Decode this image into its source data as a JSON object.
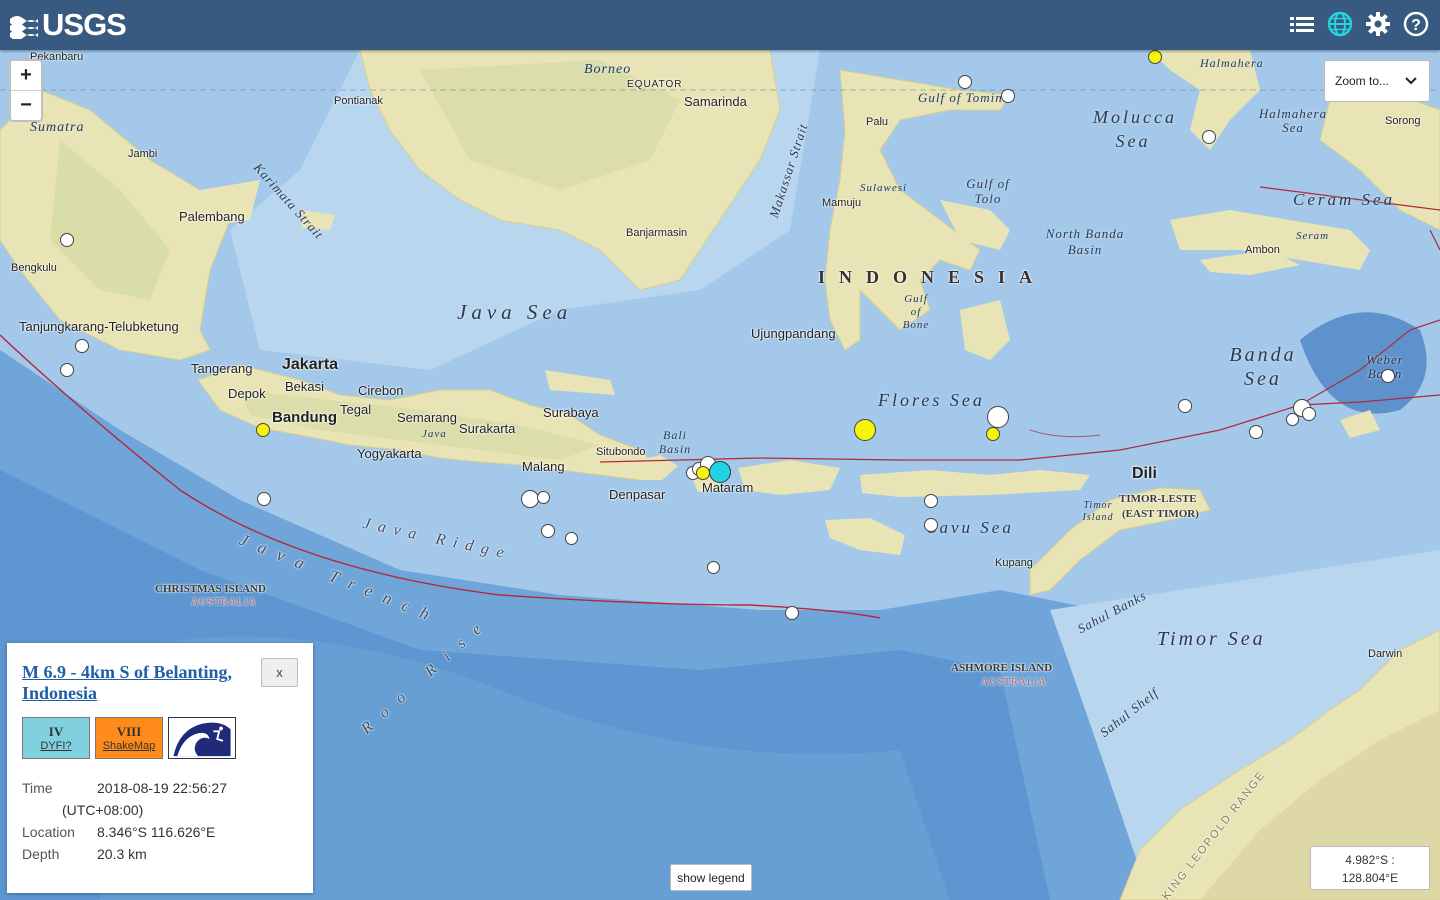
{
  "header": {
    "logo_text": "USGS",
    "icons": [
      "list-icon",
      "globe-icon",
      "gear-icon",
      "help-icon"
    ]
  },
  "map": {
    "zoom_in": "+",
    "zoom_out": "−",
    "zoom_to_label": "Zoom to...",
    "show_legend": "show legend",
    "coordinates": {
      "lat": "4.982°S :",
      "lon": "128.804°E"
    },
    "labels": {
      "pekanbaru": "Pekanbaru",
      "borneo": "Borneo",
      "equator": "EQUATOR",
      "halmahera": "Halmahera",
      "pontianak": "Pontianak",
      "samarinda": "Samarinda",
      "gulf_tomini": "Gulf of Tomini",
      "molucca_sea": "Molucca Sea",
      "halmahera_sea": "Halmahera Sea",
      "sorong": "Sorong",
      "sumatra": "Sumatra",
      "karimata": "Karimata Strait",
      "makassar": "Makassar Strait",
      "palu": "Palu",
      "jambi": "Jambi",
      "sulawesi": "Sulawesi",
      "gulf_tolo": "Gulf of Tolo",
      "ceram_sea": "Ceram Sea",
      "mamuju": "Mamuju",
      "palembang": "Palembang",
      "banjarmasin": "Banjarmasin",
      "north_banda": "North Banda Basin",
      "seram": "Seram",
      "ambon": "Ambon",
      "bengkulu": "Bengkulu",
      "indonesia": "INDONESIA",
      "gulf_bone": "Gulf of Bone",
      "java_sea": "Java Sea",
      "tanjung": "Tanjungkarang-Telubketung",
      "ujung": "Ujungpandang",
      "banda_sea": "Banda Sea",
      "weber": "Weber Basin",
      "jakarta": "Jakarta",
      "tangerang": "Tangerang",
      "bekasi": "Bekasi",
      "cirebon": "Cirebon",
      "depok": "Depok",
      "tegal": "Tegal",
      "bandung": "Bandung",
      "semarang": "Semarang",
      "java": "Java",
      "flores_sea": "Flores Sea",
      "surabaya": "Surabaya",
      "surakarta": "Surakarta",
      "bali_basin": "Bali Basin",
      "situbondo": "Situbondo",
      "yogyakarta": "Yogyakarta",
      "malang": "Malang",
      "dili": "Dili",
      "mataram": "Mataram",
      "denpasar": "Denpasar",
      "timor_leste": "TIMOR-LESTE",
      "east_timor": "(EAST TIMOR)",
      "timor_island": "Timor Island",
      "savu_sea": "Savu Sea",
      "java_ridge": "Java Ridge",
      "kupang": "Kupang",
      "java_trench": "Java Trench",
      "christmas": "CHRISTMAS ISLAND",
      "christmas_sub": "AUSTRALIA",
      "sahul_banks": "Sahul Banks",
      "timor_sea": "Timor Sea",
      "darwin": "Darwin",
      "ashmore": "ASHMORE ISLAND",
      "ashmore_sub": "AUSTRALIA",
      "roo_rise": "Roo Rise",
      "sahul_shelf": "Sahul Shelf",
      "leopold": "KING LEOPOLD RANGE"
    }
  },
  "event": {
    "title": "M 6.9 - 4km S of Belanting, Indonesia",
    "close": "x",
    "dyfi": {
      "level": "IV",
      "label": "DYFI?",
      "color": "#80d0df"
    },
    "shakemap": {
      "level": "VIII",
      "label": "ShakeMap",
      "color": "#ff8c1a"
    },
    "tsunami_icon": "tsunami-icon",
    "time_label": "Time",
    "time_value": "2018-08-19 22:56:27",
    "time_zone": "(UTC+08:00)",
    "location_label": "Location",
    "location_value": "8.346°S 116.626°E",
    "depth_label": "Depth",
    "depth_value": "20.3 km"
  },
  "colors": {
    "header": "#385a80",
    "sea": "#9fc3e6",
    "land": "#e8e3b4",
    "plate_boundary": "#b3283a",
    "link": "#1f5fa8"
  }
}
